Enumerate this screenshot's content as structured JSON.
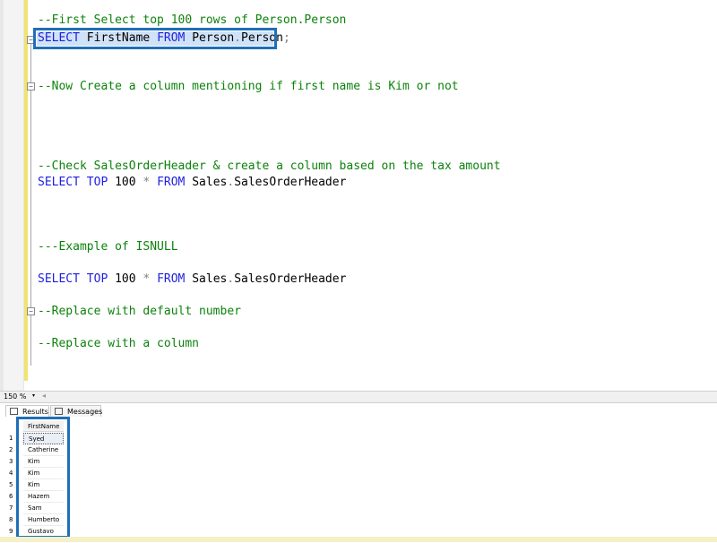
{
  "editor": {
    "lines": [
      {
        "parts": [
          {
            "t": "--First Select top 100 rows of Person.Person",
            "c": "cm"
          }
        ]
      },
      {
        "parts": [
          {
            "t": "SELECT",
            "c": "kw"
          },
          {
            "t": " FirstName ",
            "c": ""
          },
          {
            "t": "FROM",
            "c": "kw"
          },
          {
            "t": " Person",
            "c": ""
          },
          {
            "t": ".",
            "c": "op"
          },
          {
            "t": "Person",
            "c": ""
          },
          {
            "t": ";",
            "c": "op"
          }
        ]
      },
      {
        "parts": [
          {
            "t": "--Now Create a column mentioning if first name is Kim or not",
            "c": "cm"
          }
        ]
      },
      {
        "parts": [
          {
            "t": "--Check SalesOrderHeader & create a column based on the tax amount",
            "c": "cm"
          }
        ]
      },
      {
        "parts": [
          {
            "t": "SELECT",
            "c": "kw"
          },
          {
            "t": " ",
            "c": ""
          },
          {
            "t": "TOP",
            "c": "kw"
          },
          {
            "t": " 100 ",
            "c": ""
          },
          {
            "t": "*",
            "c": "op"
          },
          {
            "t": " ",
            "c": ""
          },
          {
            "t": "FROM",
            "c": "kw"
          },
          {
            "t": " Sales",
            "c": ""
          },
          {
            "t": ".",
            "c": "op"
          },
          {
            "t": "SalesOrderHeader",
            "c": ""
          }
        ]
      },
      {
        "parts": [
          {
            "t": "---Example of ISNULL",
            "c": "cm"
          }
        ]
      },
      {
        "parts": [
          {
            "t": "SELECT",
            "c": "kw"
          },
          {
            "t": " ",
            "c": ""
          },
          {
            "t": "TOP",
            "c": "kw"
          },
          {
            "t": " 100 ",
            "c": ""
          },
          {
            "t": "*",
            "c": "op"
          },
          {
            "t": " ",
            "c": ""
          },
          {
            "t": "FROM",
            "c": "kw"
          },
          {
            "t": " Sales",
            "c": ""
          },
          {
            "t": ".",
            "c": "op"
          },
          {
            "t": "SalesOrderHeader",
            "c": ""
          }
        ]
      },
      {
        "parts": [
          {
            "t": "--Replace with default number",
            "c": "cm"
          }
        ]
      },
      {
        "parts": [
          {
            "t": "--Replace with a column",
            "c": "cm"
          }
        ]
      }
    ]
  },
  "status": {
    "zoom": "150 %",
    "zoom_arrow": "▾",
    "scroll_left": "◂"
  },
  "results": {
    "tabs": [
      {
        "label": "Results"
      },
      {
        "label": "Messages"
      }
    ],
    "column_header": "FirstName",
    "rows": [
      {
        "num": "1",
        "value": "Syed"
      },
      {
        "num": "2",
        "value": "Catherine"
      },
      {
        "num": "3",
        "value": "Kim"
      },
      {
        "num": "4",
        "value": "Kim"
      },
      {
        "num": "5",
        "value": "Kim"
      },
      {
        "num": "6",
        "value": "Hazem"
      },
      {
        "num": "7",
        "value": "Sam"
      },
      {
        "num": "8",
        "value": "Humberto"
      },
      {
        "num": "9",
        "value": "Gustavo"
      }
    ]
  },
  "colors": {
    "keyword": "#1e1ee0",
    "comment": "#0c820c",
    "highlight_outline": "#1f6fb8"
  }
}
